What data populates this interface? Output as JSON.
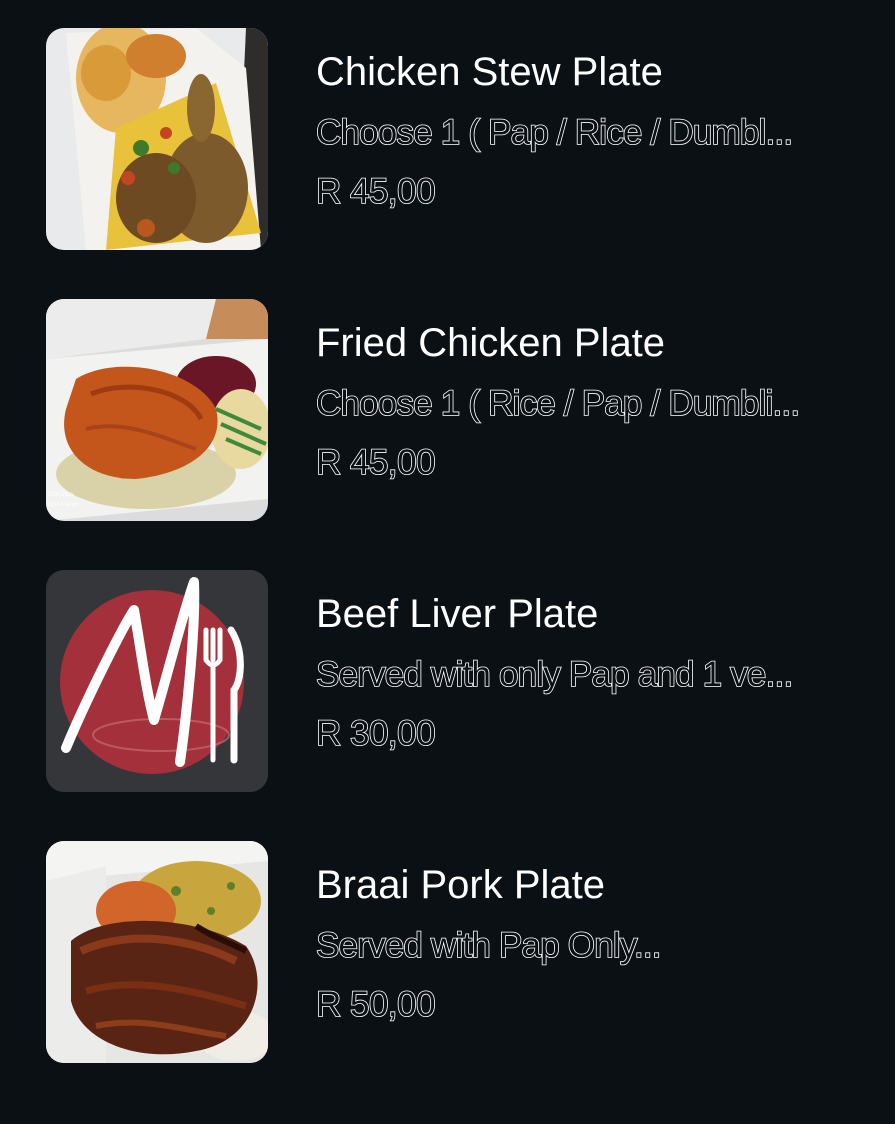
{
  "menu": {
    "items": [
      {
        "title": "Chicken Stew Plate",
        "description": "Choose  1 ( Pap / Rice / Dumbl...",
        "price": "R 45,00",
        "image": "chicken-stew-photo"
      },
      {
        "title": "Fried Chicken Plate",
        "description": "Choose 1 ( Rice / Pap / Dumbli...",
        "price": "R 45,00",
        "image": "fried-chicken-photo"
      },
      {
        "title": "Beef Liver Plate",
        "description": "Served with only Pap and 1 ve...",
        "price": "R 30,00",
        "image": "restaurant-logo-m-fork-knife"
      },
      {
        "title": "Braai Pork Plate",
        "description": "Served with Pap Only...",
        "price": "R 50,00",
        "image": "braai-pork-photo"
      }
    ]
  },
  "colors": {
    "background": "#0b1015",
    "text": "#ffffff",
    "logo_red": "#a3303a",
    "logo_bg": "#35363a"
  }
}
